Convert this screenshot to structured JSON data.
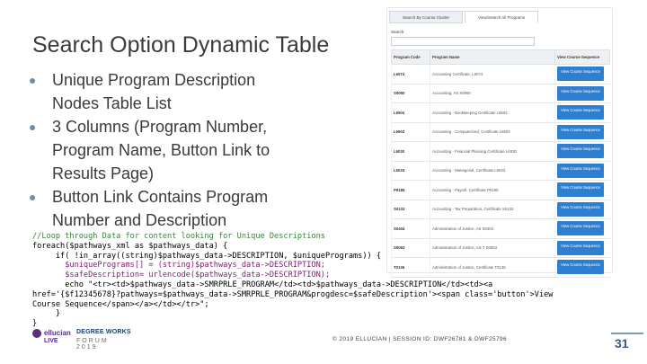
{
  "slide": {
    "title": "Search Option Dynamic Table",
    "bullets": [
      "Unique Program Description Nodes Table List",
      "3 Columns (Program Number, Program Name, Button Link to Results Page)",
      "Button Link Contains Program Number and Description"
    ],
    "bullet_marker": "●",
    "code_lines": [
      "//Loop through Data for content looking for Unique Descriptions",
      "foreach($pathways_xml as $pathways_data) {",
      "     if( !in_array((string)$pathways_data->DESCRIPTION, $uniquePrograms)) {",
      "       $uniquePrograms[] = (string)$pathways_data->DESCRIPTION;",
      "       $safeDescription= urlencode($pathways_data->DESCRIPTION);",
      "       echo \"<tr><td>$pathways_data->SMRPRLE_PROGRAM</td><td>$pathways_data->DESCRIPTION</td><td><a",
      "href='{$f12345678}?pathways=$pathways_data->SMRPRLE_PROGRAM&progdesc=$safeDescription'><span class='button'>View",
      "Course Sequence</span></a></td></tr>\";",
      "     }",
      "}"
    ],
    "page_number": "31",
    "copyright": "© 2019 ELLUCIAN | SESSION ID: DWF26781 & DWF25796"
  },
  "logo": {
    "brand": "ellucian",
    "live": "LIVE",
    "degree": "DEGREE WORKS",
    "forum": "FORUM 2019"
  },
  "panel": {
    "tabs": [
      "Search By Course Cluster",
      "View/Search All Programs"
    ],
    "active_tab": 1,
    "search_label": "Search:",
    "search_value": "",
    "columns": [
      "Program Code",
      "Program Name",
      "View Course Sequence"
    ],
    "rows": [
      {
        "code": "L6074",
        "name": "Accounting Certificate, L6074",
        "button": "View Course Sequence"
      },
      {
        "code": "S0060",
        "name": "Accounting, AS S0060",
        "button": "View Course Sequence"
      },
      {
        "code": "L6504",
        "name": "Accounting - Bookkeeping Certificate L6504",
        "button": "View Course Sequence"
      },
      {
        "code": "L6503",
        "name": "Accounting - Computerized, Certificate L6503",
        "button": "View Course Sequence"
      },
      {
        "code": "L6030",
        "name": "Accounting - Financial Planning Certificate L6030",
        "button": "View Course Sequence"
      },
      {
        "code": "L6033",
        "name": "Accounting - Managerial, Certificate L6033",
        "button": "View Course Sequence"
      },
      {
        "code": "P9185",
        "name": "Accounting - Payroll, Certificate P9185",
        "button": "View Course Sequence"
      },
      {
        "code": "S0133",
        "name": "Accounting - Tax Preparation, Certificate S0133",
        "button": "View Course Sequence"
      },
      {
        "code": "S0404",
        "name": "Administration of Justice, AS S0404",
        "button": "View Course Sequence"
      },
      {
        "code": "S0063",
        "name": "Administration of Justice, AS-T S0063",
        "button": "View Course Sequence"
      },
      {
        "code": "T0136",
        "name": "Administration of Justice, Certificate T0136",
        "button": "View Course Sequence"
      }
    ]
  },
  "colors": {
    "accent_button": "#2f7fd1",
    "bullet": "#6b8fb0",
    "brand_purple": "#5a2d82"
  }
}
